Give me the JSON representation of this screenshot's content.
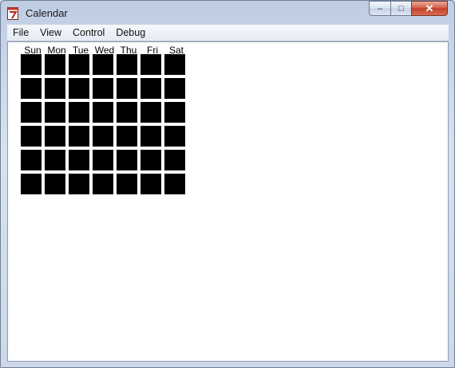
{
  "window": {
    "title": "Calendar",
    "controls": {
      "minimize": "–",
      "maximize": "□",
      "close": "✕"
    }
  },
  "menu": {
    "items": [
      {
        "label": "File"
      },
      {
        "label": "View"
      },
      {
        "label": "Control"
      },
      {
        "label": "Debug"
      }
    ]
  },
  "calendar": {
    "days": [
      "Sun",
      "Mon",
      "Tue",
      "Wed",
      "Thu",
      "Fri",
      "Sat"
    ],
    "cell_color": "#000000"
  }
}
